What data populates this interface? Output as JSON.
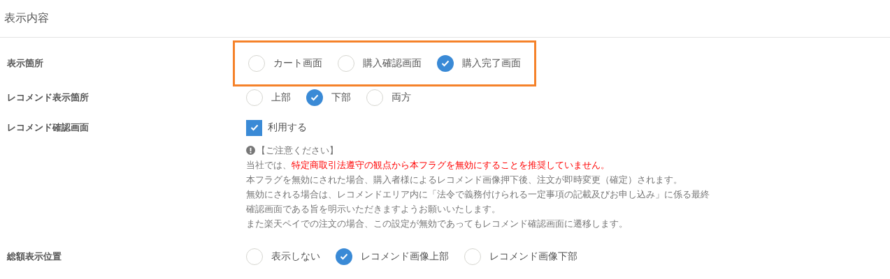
{
  "section": {
    "title": "表示内容"
  },
  "rows": [
    {
      "label": "表示箇所",
      "kind": "radio",
      "highlighted": true,
      "options": [
        {
          "label": "カート画面",
          "selected": false
        },
        {
          "label": "購入確認画面",
          "selected": false
        },
        {
          "label": "購入完了画面",
          "selected": true
        }
      ]
    },
    {
      "label": "レコメンド表示箇所",
      "kind": "radio",
      "highlighted": false,
      "options": [
        {
          "label": "上部",
          "selected": false
        },
        {
          "label": "下部",
          "selected": true
        },
        {
          "label": "両方",
          "selected": false
        }
      ]
    },
    {
      "label": "レコメンド確認画面",
      "kind": "checkbox",
      "highlighted": false,
      "options": [
        {
          "label": "利用する",
          "checked": true
        }
      ],
      "notice": {
        "heading": "【ご注意ください】",
        "warning_prefix": "当社では、",
        "warning": "特定商取引法遵守の観点から本フラグを無効にすることを推奨していません。",
        "lines": [
          "本フラグを無効にされた場合、購入者様によるレコメンド画像押下後、注文が即時変更（確定）されます。",
          "無効にされる場合は、レコメンドエリア内に「法令で義務付けられる一定事項の記載及びお申し込み」に係る最終確認画面である旨を明示いただきますようお願いいたします。",
          "また楽天ペイでの注文の場合、この設定が無効であってもレコメンド確認画面に遷移します。"
        ]
      }
    },
    {
      "label": "総額表示位置",
      "kind": "radio",
      "highlighted": false,
      "options": [
        {
          "label": "表示しない",
          "selected": false
        },
        {
          "label": "レコメンド画像上部",
          "selected": true
        },
        {
          "label": "レコメンド画像下部",
          "selected": false
        }
      ]
    }
  ]
}
